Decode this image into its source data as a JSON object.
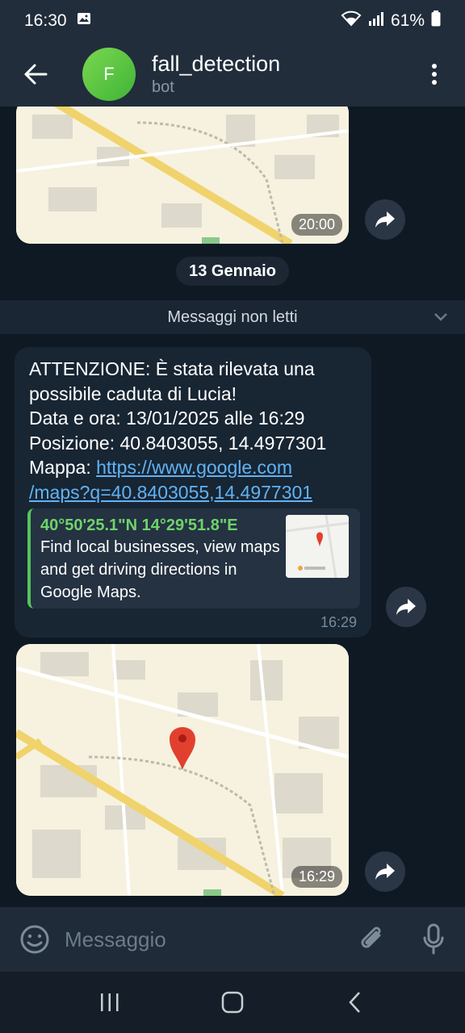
{
  "status_bar": {
    "time": "16:30",
    "battery": "61%",
    "icons": [
      "image-icon",
      "wifi-icon",
      "signal-icon",
      "battery-icon"
    ]
  },
  "header": {
    "avatar_letter": "F",
    "title": "fall_detection",
    "subtitle": "bot",
    "avatar_color": "#5cc646"
  },
  "messages": {
    "top_map_time": "20:00",
    "date_chip": "13 Gennaio",
    "unread_label": "Messaggi non letti",
    "alert": {
      "line1": "ATTENZIONE: È stata rilevata una",
      "line2": "possibile caduta di Lucia!",
      "line3": "Data e ora: 13/01/2025 alle 16:29",
      "line4": "Posizione: 40.8403055, 14.4977301",
      "map_label": "Mappa: ",
      "link_part1": "https://www.google.com",
      "link_part2": "/maps?q=40.8403055,14.4977301",
      "time": "16:29"
    },
    "preview": {
      "title": "40°50'25.1\"N 14°29'51.8\"E",
      "description": "Find local businesses, view maps and get driving directions in Google Maps."
    },
    "bottom_map_time": "16:29"
  },
  "input": {
    "placeholder": "Messaggio"
  },
  "colors": {
    "background": "#0f1924",
    "bubble": "#182533",
    "link": "#5fb3f5",
    "preview_accent": "#55c55b"
  }
}
